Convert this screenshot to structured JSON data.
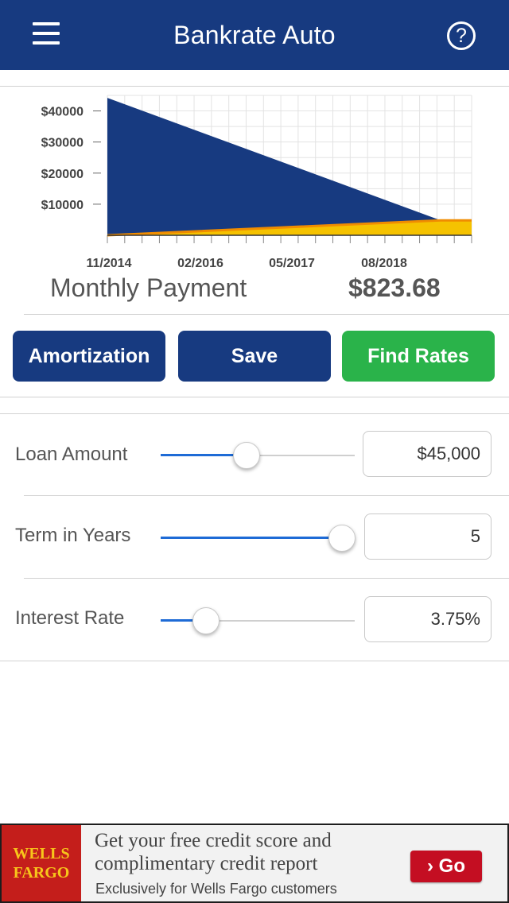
{
  "header": {
    "title": "Bankrate Auto",
    "help_glyph": "?",
    "menu_icon": "menu-icon",
    "help_icon": "question-circle-icon"
  },
  "chart_data": {
    "type": "area",
    "title": "",
    "xlabel": "",
    "ylabel": "",
    "y_tick_labels": [
      "$40000",
      "$30000",
      "$20000",
      "$10000"
    ],
    "y_ticks": [
      40000,
      30000,
      20000,
      10000
    ],
    "x_tick_labels": [
      "11/2014",
      "02/2016",
      "05/2017",
      "08/2018"
    ],
    "ylim": [
      0,
      45000
    ],
    "grid": true,
    "series": [
      {
        "color": "#173a80",
        "points": [
          [
            0,
            44200
          ],
          [
            54,
            4800
          ]
        ]
      },
      {
        "color": "#f5c200",
        "points": [
          [
            0,
            0
          ],
          [
            54,
            4800
          ],
          [
            59,
            4800
          ]
        ]
      }
    ]
  },
  "summary": {
    "label": "Monthly Payment",
    "value": "$823.68"
  },
  "buttons": {
    "amortization": "Amortization",
    "save": "Save",
    "find_rates": "Find Rates"
  },
  "inputs": {
    "loan_amount": {
      "label": "Loan Amount",
      "value": "$45,000",
      "slider_fraction": 0.44
    },
    "term": {
      "label": "Term in Years",
      "value": "5",
      "slider_fraction": 0.93
    },
    "rate": {
      "label": "Interest Rate",
      "value": "3.75%",
      "slider_fraction": 0.23
    }
  },
  "ad": {
    "logo_line1": "WELLS",
    "logo_line2": "FARGO",
    "line1": "Get your free credit score and",
    "line2": "complimentary credit report",
    "line3": "Exclusively for Wells Fargo customers",
    "button": "› Go",
    "colors": {
      "logo_bg": "#c41e1b",
      "logo_text": "#f7c61b",
      "button": "#c40e22"
    }
  },
  "colors": {
    "brand": "#173a80",
    "accent_green": "#2ab34a",
    "slider": "#1e6bd6"
  }
}
